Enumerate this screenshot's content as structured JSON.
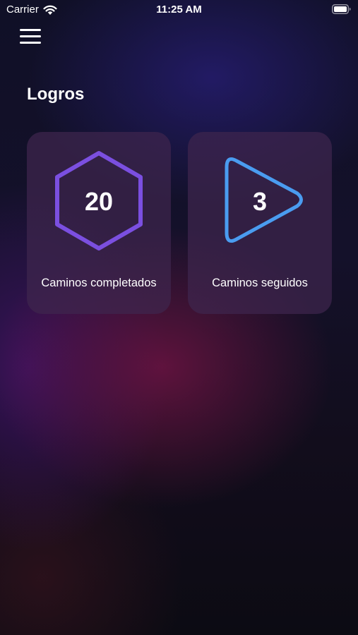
{
  "status_bar": {
    "carrier": "Carrier",
    "time": "11:25 AM"
  },
  "header": {
    "menu_icon": "hamburger-menu-icon",
    "title": "Logros"
  },
  "achievements": [
    {
      "value": "20",
      "label": "Caminos completados",
      "icon": "hexagon-icon",
      "accent": "#7b4fe0"
    },
    {
      "value": "3",
      "label": "Caminos seguidos",
      "icon": "play-triangle-icon",
      "accent": "#4a9cf0"
    }
  ],
  "colors": {
    "background": "#0d0c18",
    "card_background": "#3f264e",
    "text": "#ffffff"
  }
}
